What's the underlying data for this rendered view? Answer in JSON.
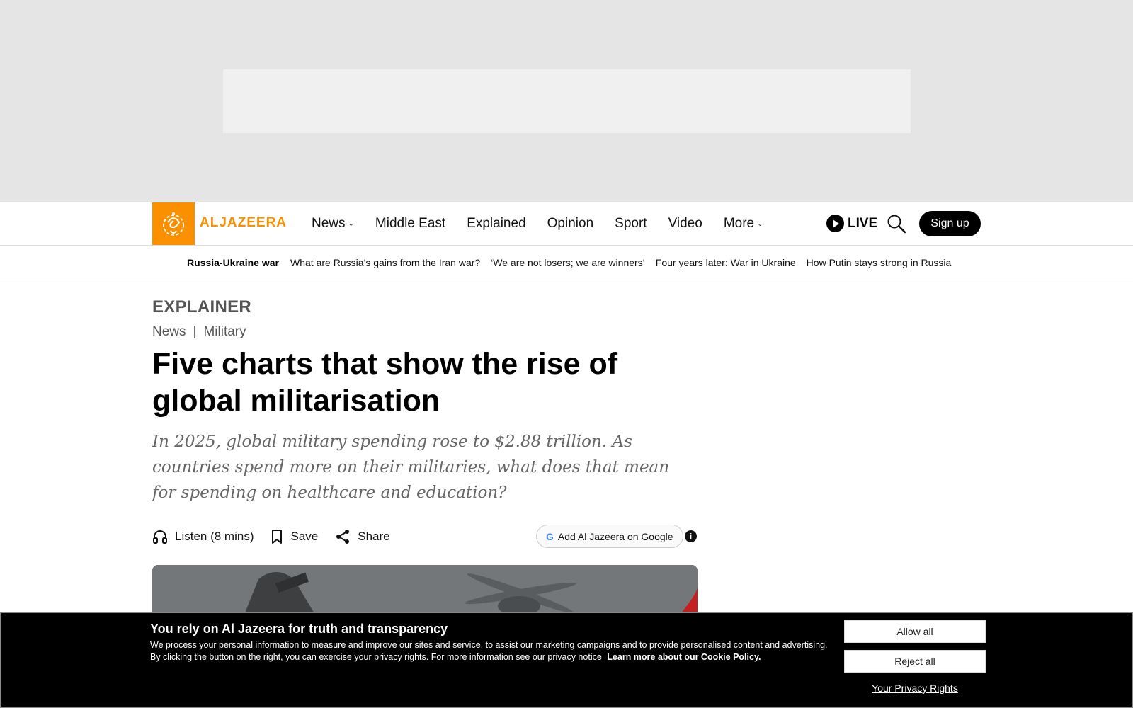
{
  "brand": {
    "name": "ALJAZEERA",
    "accent_color": "#fa9000",
    "logo_icon": "aljazeera-calligraphy-logo"
  },
  "nav": {
    "items": [
      {
        "label": "News",
        "has_dropdown": true
      },
      {
        "label": "Middle East",
        "has_dropdown": false
      },
      {
        "label": "Explained",
        "has_dropdown": false
      },
      {
        "label": "Opinion",
        "has_dropdown": false
      },
      {
        "label": "Sport",
        "has_dropdown": false
      },
      {
        "label": "Video",
        "has_dropdown": false
      },
      {
        "label": "More",
        "has_dropdown": true
      }
    ],
    "live_label": "LIVE",
    "signup_label": "Sign up"
  },
  "topic_bar": {
    "title": "Russia-Ukraine war",
    "links": [
      "What are Russia’s gains from the Iran war?",
      "‘We are not losers; we are winners’",
      "Four years later: War in Ukraine",
      "How Putin stays strong in Russia"
    ]
  },
  "article": {
    "kicker": "EXPLAINER",
    "breadcrumb": [
      "News",
      "Military"
    ],
    "breadcrumb_separator": "|",
    "headline": "Five charts that show the rise of global militarisation",
    "subhead": "In 2025, global military spending rose to $2.88 trillion. As countries spend more on their militaries, what does that mean for spending on healthcare and education?",
    "tools": {
      "listen_label": "Listen (8 mins)",
      "save_label": "Save",
      "share_label": "Share",
      "google_label": "Add Al Jazeera on Google",
      "google_glyph": "G",
      "info_glyph": "i"
    }
  },
  "cookie_banner": {
    "title": "You rely on Al Jazeera for truth and transparency",
    "text": "We process your personal information to measure and improve our sites and service, to assist our marketing campaigns and to provide personalised content and advertising. By clicking the button on the right, you can exercise your privacy rights. For more information see our privacy notice",
    "link_label": "Learn more about our Cookie Policy.",
    "allow_label": "Allow all",
    "reject_label": "Reject all",
    "privacy_label": "Your Privacy Rights"
  }
}
